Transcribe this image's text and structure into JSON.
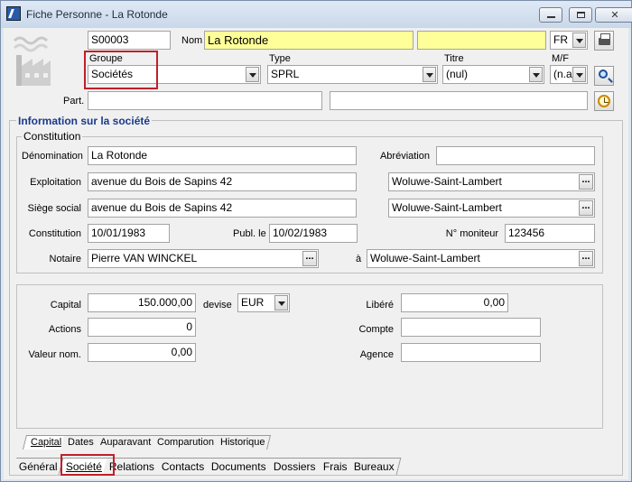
{
  "window": {
    "title": "Fiche Personne - La Rotonde"
  },
  "header": {
    "code": "S00003",
    "nom_label": "Nom",
    "nom_value": "La Rotonde",
    "nom_extra": "",
    "lang_value": "FR",
    "groupe_label": "Groupe",
    "groupe_value": "Sociétés",
    "type_label": "Type",
    "type_value": "SPRL",
    "titre_label": "Titre",
    "titre_value": "(nul)",
    "mf_label": "M/F",
    "mf_value": "(n.a",
    "part_label": "Part.",
    "part_value": "",
    "part_value2": ""
  },
  "info": {
    "section_title": "Information sur la société",
    "constitution_group": "Constitution",
    "denomination_label": "Dénomination",
    "denomination_value": "La Rotonde",
    "abreviation_label": "Abréviation",
    "abreviation_value": "",
    "exploitation_label": "Exploitation",
    "exploitation_value": "avenue du Bois de Sapins 42",
    "exploitation_commune": "Woluwe-Saint-Lambert",
    "siege_label": "Siège social",
    "siege_value": "avenue du Bois de Sapins 42",
    "siege_commune": "Woluwe-Saint-Lambert",
    "constitution_label": "Constitution",
    "constitution_value": "10/01/1983",
    "publ_label": "Publ. le",
    "publ_value": "10/02/1983",
    "moniteur_label": "N° moniteur",
    "moniteur_value": "123456",
    "notaire_label": "Notaire",
    "notaire_value": "Pierre VAN WINCKEL",
    "a_label": "à",
    "a_value": "Woluwe-Saint-Lambert"
  },
  "capital": {
    "capital_label": "Capital",
    "capital_value": "150.000,00",
    "devise_label": "devise",
    "devise_value": "EUR",
    "libere_label": "Libéré",
    "libere_value": "0,00",
    "actions_label": "Actions",
    "actions_value": "0",
    "compte_label": "Compte",
    "compte_value": "",
    "valeur_label": "Valeur nom.",
    "valeur_value": "0,00",
    "agence_label": "Agence",
    "agence_value": ""
  },
  "inner_tabs": [
    "Capital",
    "Dates",
    "Auparavant",
    "Comparution",
    "Historique"
  ],
  "bottom_tabs": [
    "Général",
    "Société",
    "Relations",
    "Contacts",
    "Documents",
    "Dossiers",
    "Frais",
    "Bureaux"
  ],
  "colors": {
    "highlight": "#c0202a",
    "name_field": "#ffff99",
    "section_title": "#1a3a8a"
  },
  "icons": {
    "print": "printer-icon",
    "search": "search-icon",
    "history": "clock-icon",
    "entity": "factory-icon"
  }
}
